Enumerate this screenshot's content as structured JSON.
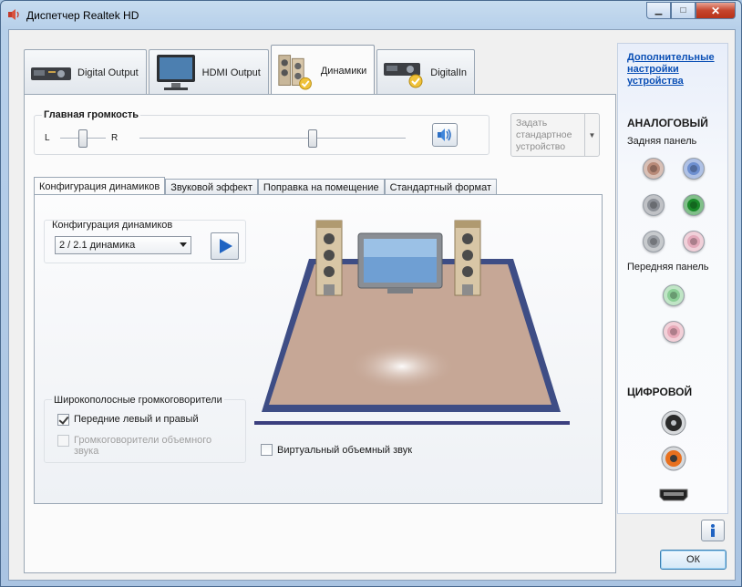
{
  "window": {
    "title": "Диспетчер Realtek HD"
  },
  "device_tabs": [
    {
      "label": "Digital Output",
      "icon": "receiver-icon",
      "active": false
    },
    {
      "label": "HDMI Output",
      "icon": "monitor-icon",
      "active": false
    },
    {
      "label": "Динамики",
      "icon": "speakers-icon",
      "active": true
    },
    {
      "label": "DigitalIn",
      "icon": "receiver-icon",
      "active": false
    }
  ],
  "main_volume": {
    "label": "Главная громкость",
    "left_label": "L",
    "right_label": "R",
    "balance_pct": 50,
    "volume_pct": 65
  },
  "set_default": {
    "label": "Задать стандартное устройство"
  },
  "sub_tabs": [
    {
      "label": "Конфигурация динамиков",
      "active": true
    },
    {
      "label": "Звуковой эффект",
      "active": false
    },
    {
      "label": "Поправка на помещение",
      "active": false
    },
    {
      "label": "Стандартный формат",
      "active": false
    }
  ],
  "speaker_config": {
    "group_label": "Конфигурация динамиков",
    "selected": "2 / 2.1 динамика"
  },
  "fullrange": {
    "group_label": "Широкополосные громкоговорители",
    "front_lr": {
      "label": "Передние левый и правый",
      "checked": true
    },
    "surround": {
      "label": "Громкоговорители объемного звука",
      "checked": false,
      "enabled": false
    }
  },
  "virtual_surround": {
    "label": "Виртуальный объемный звук",
    "checked": false
  },
  "side": {
    "link": "Дополнительные настройки устройства",
    "analog_title": "АНАЛОГОВЫЙ",
    "rear_panel": "Задняя панель",
    "front_panel": "Передняя панель",
    "digital_title": "ЦИФРОВОЙ",
    "rear_jacks": [
      "#b88a78",
      "#6d8fd0",
      "#8c9097",
      "#1a8a2a",
      "#9a9ea4",
      "#e3a9ba"
    ],
    "front_jacks": [
      "#8ccf97",
      "#e7a9b8"
    ],
    "digital_jacks": [
      "#2a2a2a",
      "#e8701e"
    ]
  },
  "buttons": {
    "ok": "ОК"
  }
}
